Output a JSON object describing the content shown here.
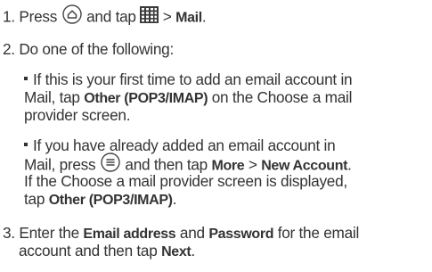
{
  "steps": [
    {
      "number": "1.",
      "line1": {
        "t1": "Press",
        "home_key_icon": "home-key",
        "t2": "and tap",
        "apps_icon": "all-apps-grid",
        "t3": ">",
        "t4": "Mail",
        "t5": "."
      }
    },
    {
      "number": "2.",
      "text": "Do one of the following:",
      "bullets": [
        {
          "l1": "If this is your first time to add an email account in",
          "l2a": "Mail, tap",
          "l2b": "Other (POP3/IMAP)",
          "l2c": "on the Choose a mail",
          "l3": "provider screen."
        },
        {
          "l1": "If you have already added an email account in",
          "l2a": "Mail, press",
          "menu_key_icon": "menu-key",
          "l2b": "and then tap",
          "l2c": "More",
          "l2d": ">",
          "l2e": "New Account",
          "l2f": ".",
          "l3": "If the Choose a mail provider screen is displayed,",
          "l4a": "tap",
          "l4b": "Other (POP3/IMAP)",
          "l4c": "."
        }
      ]
    },
    {
      "number": "3.",
      "l1a": "Enter the",
      "l1b": "Email address",
      "l1c": "and",
      "l1d": "Password",
      "l1e": "for the email",
      "l2a": "account and then tap",
      "l2b": "Next",
      "l2c": "."
    }
  ]
}
